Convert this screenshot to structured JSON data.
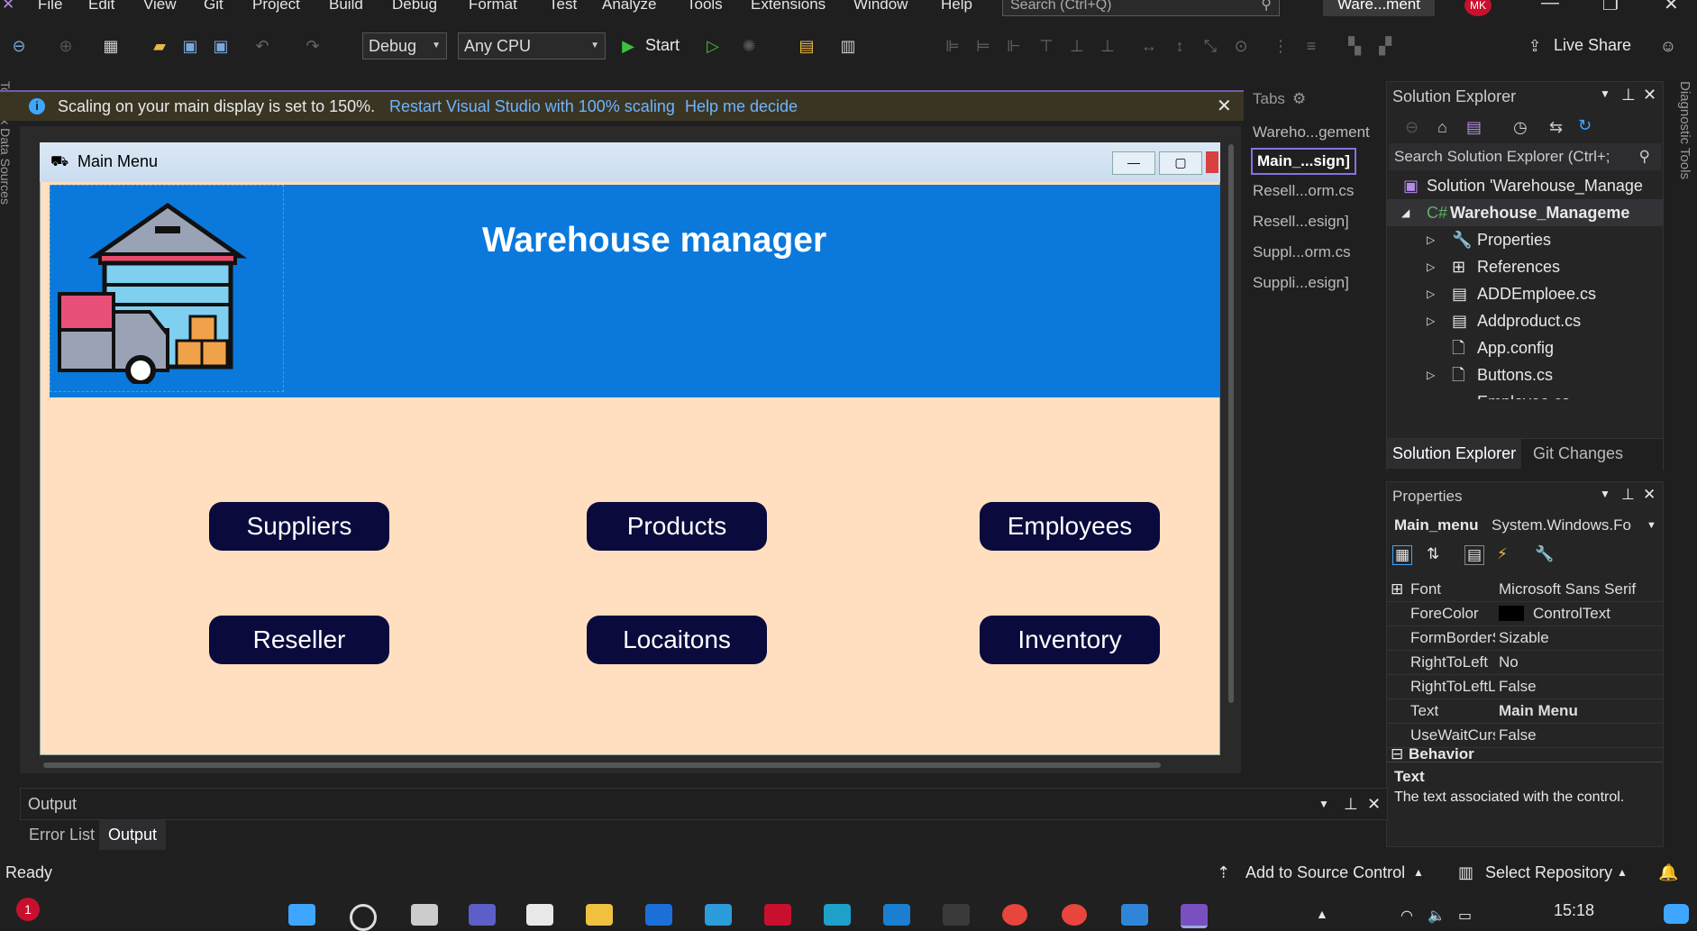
{
  "menu": [
    "File",
    "Edit",
    "View",
    "Git",
    "Project",
    "Build",
    "Debug",
    "Format",
    "Test",
    "Analyze",
    "Tools",
    "Extensions",
    "Window",
    "Help"
  ],
  "search_placeholder": "Search (Ctrl+Q)",
  "window_title": "Ware...ment",
  "avatar_initials": "MK",
  "toolbar": {
    "config": "Debug",
    "platform": "Any CPU",
    "start": "Start",
    "live_share": "Live Share"
  },
  "infobar": {
    "message": "Scaling on your main display is set to 150%.",
    "link1": "Restart Visual Studio with 100% scaling",
    "link2": "Help me decide"
  },
  "form": {
    "title": "Main Menu",
    "heading": "Warehouse manager",
    "buttons": [
      "Suppliers",
      "Products",
      "Employees",
      "Reseller",
      "Locaitons",
      "Inventory"
    ]
  },
  "tabs": {
    "header": "Tabs",
    "items": [
      "Wareho...gement",
      "Main_...sign]",
      "Resell...orm.cs",
      "Resell...esign]",
      "Suppl...orm.cs",
      "Suppli...esign]"
    ]
  },
  "solution_explorer": {
    "title": "Solution Explorer",
    "search": "Search Solution Explorer (Ctrl+;",
    "items": [
      "Solution 'Warehouse_Manage",
      "Warehouse_Manageme",
      "Properties",
      "References",
      "ADDEmploee.cs",
      "Addproduct.cs",
      "App.config",
      "Buttons.cs",
      "Employee.cs"
    ],
    "bottom_tabs": [
      "Solution Explorer",
      "Git Changes"
    ]
  },
  "properties": {
    "title": "Properties",
    "object": "Main_menu",
    "object_type": "System.Windows.Fo",
    "rows": [
      {
        "name": "Font",
        "value": "Microsoft Sans Serif"
      },
      {
        "name": "ForeColor",
        "value": "ControlText"
      },
      {
        "name": "FormBorderStyle",
        "value": "Sizable"
      },
      {
        "name": "RightToLeft",
        "value": "No"
      },
      {
        "name": "RightToLeftLayout",
        "value": "False"
      },
      {
        "name": "Text",
        "value": "Main Menu"
      },
      {
        "name": "UseWaitCursor",
        "value": "False"
      }
    ],
    "category": "Behavior",
    "desc_title": "Text",
    "desc_body": "The text associated with the control."
  },
  "output": {
    "title": "Output",
    "tabs": [
      "Error List",
      "Output"
    ]
  },
  "status": {
    "left": "Ready",
    "source_control": "Add to Source Control",
    "repo": "Select Repository"
  },
  "clock": "15:18",
  "side_labels": {
    "left": "Toolbox   Data Sources",
    "right": "Diagnostic Tools"
  },
  "colors": {
    "form_bg": "#ffdfbf",
    "header_blue": "#0a79db",
    "button_bg": "#0a0a3d"
  }
}
